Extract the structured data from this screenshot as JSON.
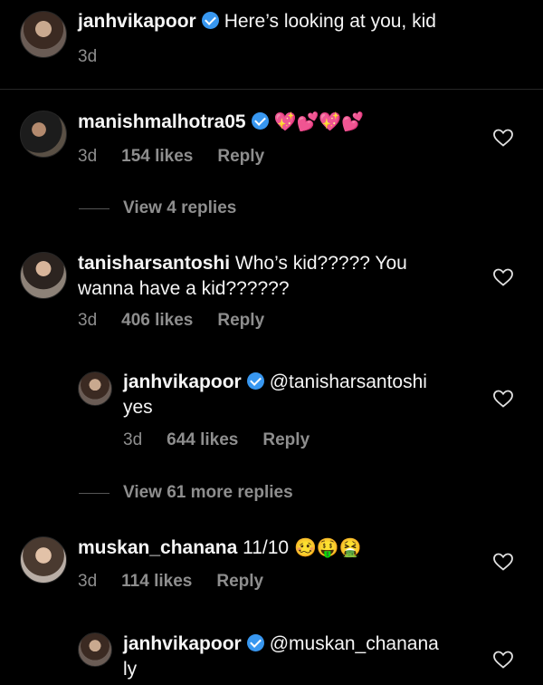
{
  "caption": {
    "username": "janhvikapoor",
    "text": "Here’s looking at you, kid",
    "time": "3d"
  },
  "comments": [
    {
      "username": "manishmalhotra05",
      "text": "💖💕💖💕",
      "time": "3d",
      "likes": "154 likes",
      "reply": "Reply",
      "view_replies": "View 4 replies"
    },
    {
      "username": "tanisharsantoshi",
      "text_line1": "Who’s kid????? You",
      "text_line2": "wanna have a kid??????",
      "time": "3d",
      "likes": "406 likes",
      "reply": "Reply",
      "replies": [
        {
          "username": "janhvikapoor",
          "text_line1": "@tanisharsantoshi",
          "text_line2": "yes",
          "time": "3d",
          "likes": "644 likes",
          "reply": "Reply"
        }
      ],
      "view_replies": "View 61 more replies"
    },
    {
      "username": "muskan_chanana",
      "text": "11/10",
      "emojis": "🥴🤑🤮",
      "time": "3d",
      "likes": "114 likes",
      "reply": "Reply",
      "replies": [
        {
          "username": "janhvikapoor",
          "text_line1": "@muskan_chanana",
          "text_line2": "ly"
        }
      ]
    }
  ],
  "icons": {
    "like": "heart-outline-icon",
    "verified": "verified-badge-icon"
  },
  "colors": {
    "background": "#000000",
    "verified": "#3897f0",
    "muted": "#8e8e8e"
  }
}
